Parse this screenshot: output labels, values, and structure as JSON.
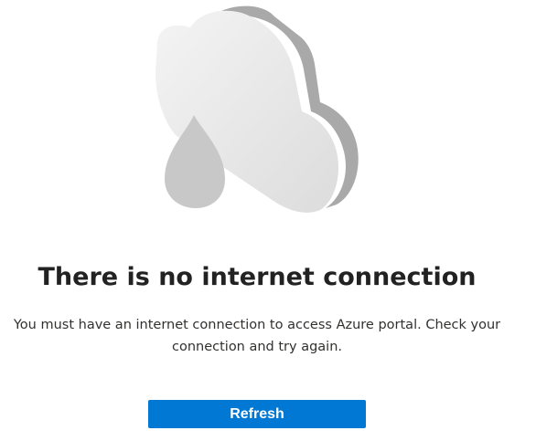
{
  "error": {
    "title": "There is no internet connection",
    "message_line1": "You must have an internet connection to access Azure portal. Check your",
    "message_line2": "connection and try again."
  },
  "actions": {
    "refresh_label": "Refresh"
  },
  "illustration": {
    "icon": "disconnected-cloud-icon",
    "colors": {
      "cloud_face": "#eaeaea",
      "cloud_side": "#a9a9a9",
      "drop": "#c8c8c8"
    }
  },
  "theme": {
    "accent": "#0078d4",
    "text": "#222222"
  }
}
